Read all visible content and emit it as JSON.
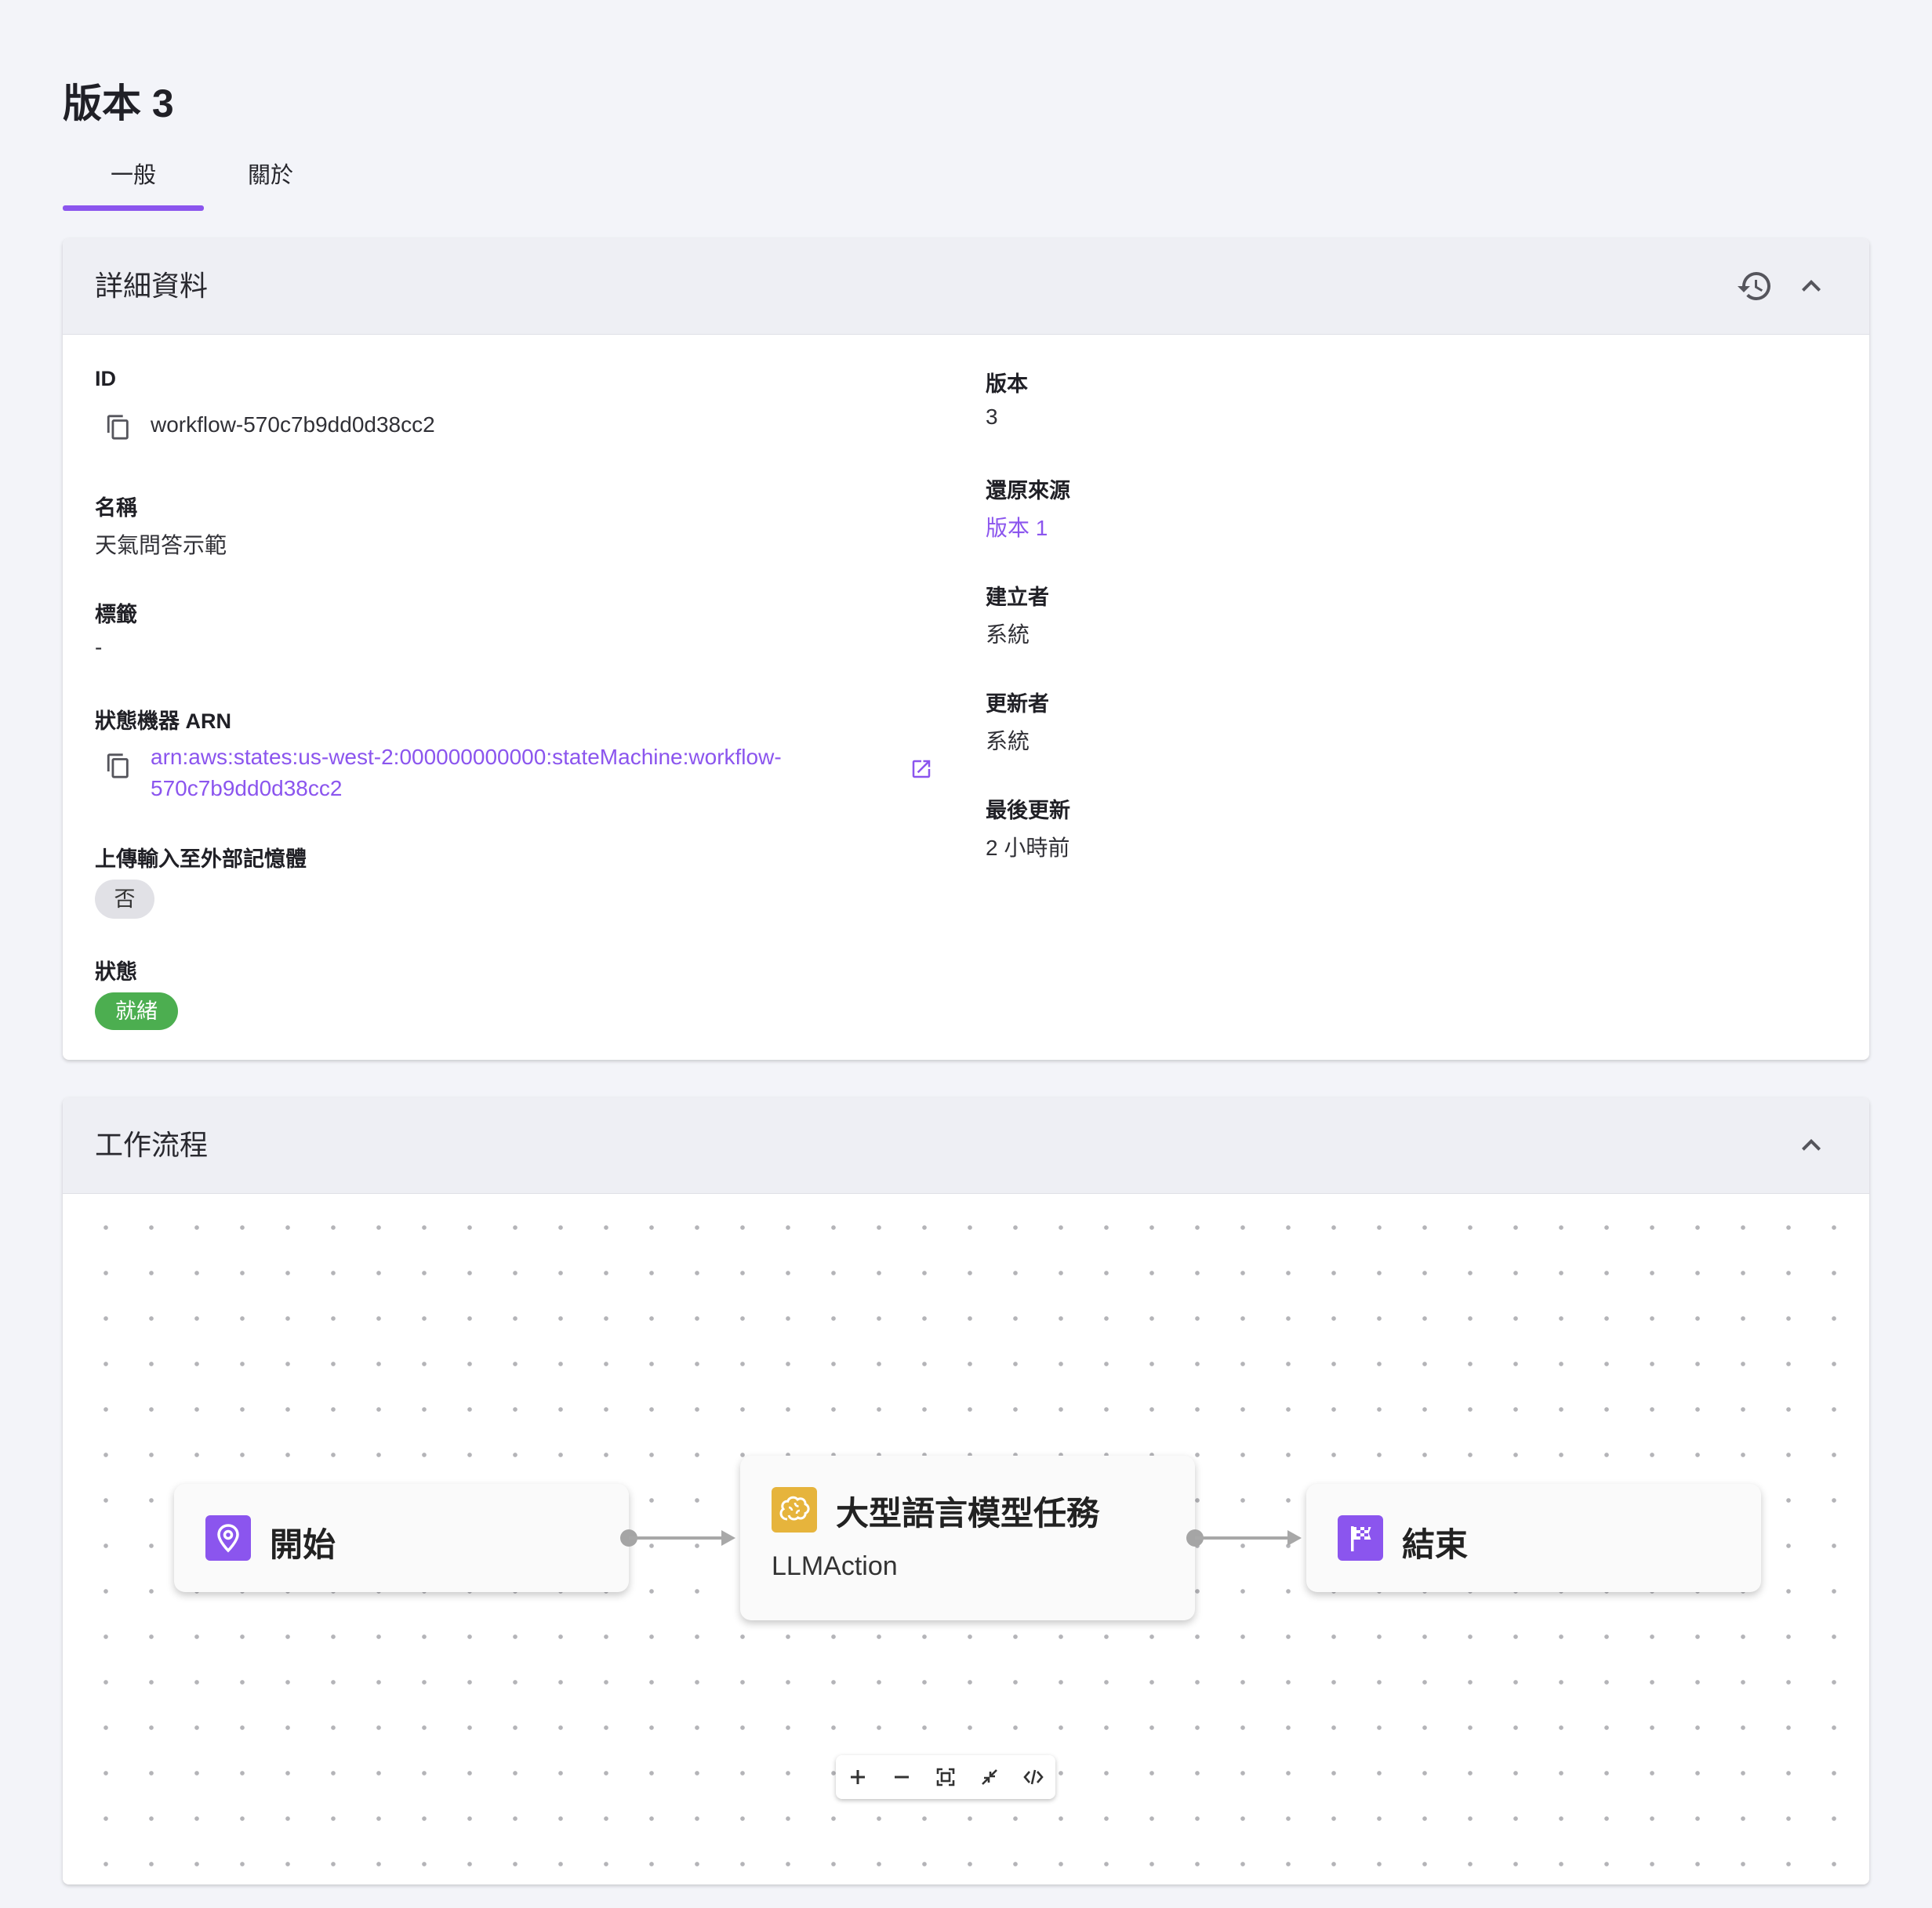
{
  "page": {
    "title": "版本 3"
  },
  "tabs": [
    {
      "label": "一般",
      "active": true
    },
    {
      "label": "關於",
      "active": false
    }
  ],
  "colors": {
    "accent": "#8b55ee",
    "status_ready": "#4cae50",
    "llm_icon": "#e6b43c"
  },
  "details": {
    "title": "詳細資料",
    "id": {
      "label": "ID",
      "value": "workflow-570c7b9dd0d38cc2"
    },
    "name": {
      "label": "名稱",
      "value": "天氣問答示範"
    },
    "tags": {
      "label": "標籤",
      "value": "-"
    },
    "arn": {
      "label": "狀態機器 ARN",
      "line1": "arn:aws:states:us-west-2:000000000000:stateMachine:workflow-",
      "line2": "570c7b9dd0d38cc2"
    },
    "upload": {
      "label": "上傳輸入至外部記憶體",
      "value": "否"
    },
    "status": {
      "label": "狀態",
      "value": "就緒"
    },
    "version": {
      "label": "版本",
      "value": "3"
    },
    "restored_from": {
      "label": "還原來源",
      "value": "版本 1"
    },
    "created_by": {
      "label": "建立者",
      "value": "系統"
    },
    "updated_by": {
      "label": "更新者",
      "value": "系統"
    },
    "last_updated": {
      "label": "最後更新",
      "value": "2 小時前"
    }
  },
  "workflow": {
    "title": "工作流程",
    "nodes": {
      "start": {
        "title": "開始",
        "icon": "map-pin-icon"
      },
      "llm": {
        "title": "大型語言模型任務",
        "subtitle": "LLMAction",
        "icon": "brain-icon"
      },
      "end": {
        "title": "結束",
        "icon": "checkered-flag-icon"
      }
    },
    "controls": [
      "zoom-in",
      "zoom-out",
      "fit-view",
      "collapse",
      "code-view"
    ]
  }
}
